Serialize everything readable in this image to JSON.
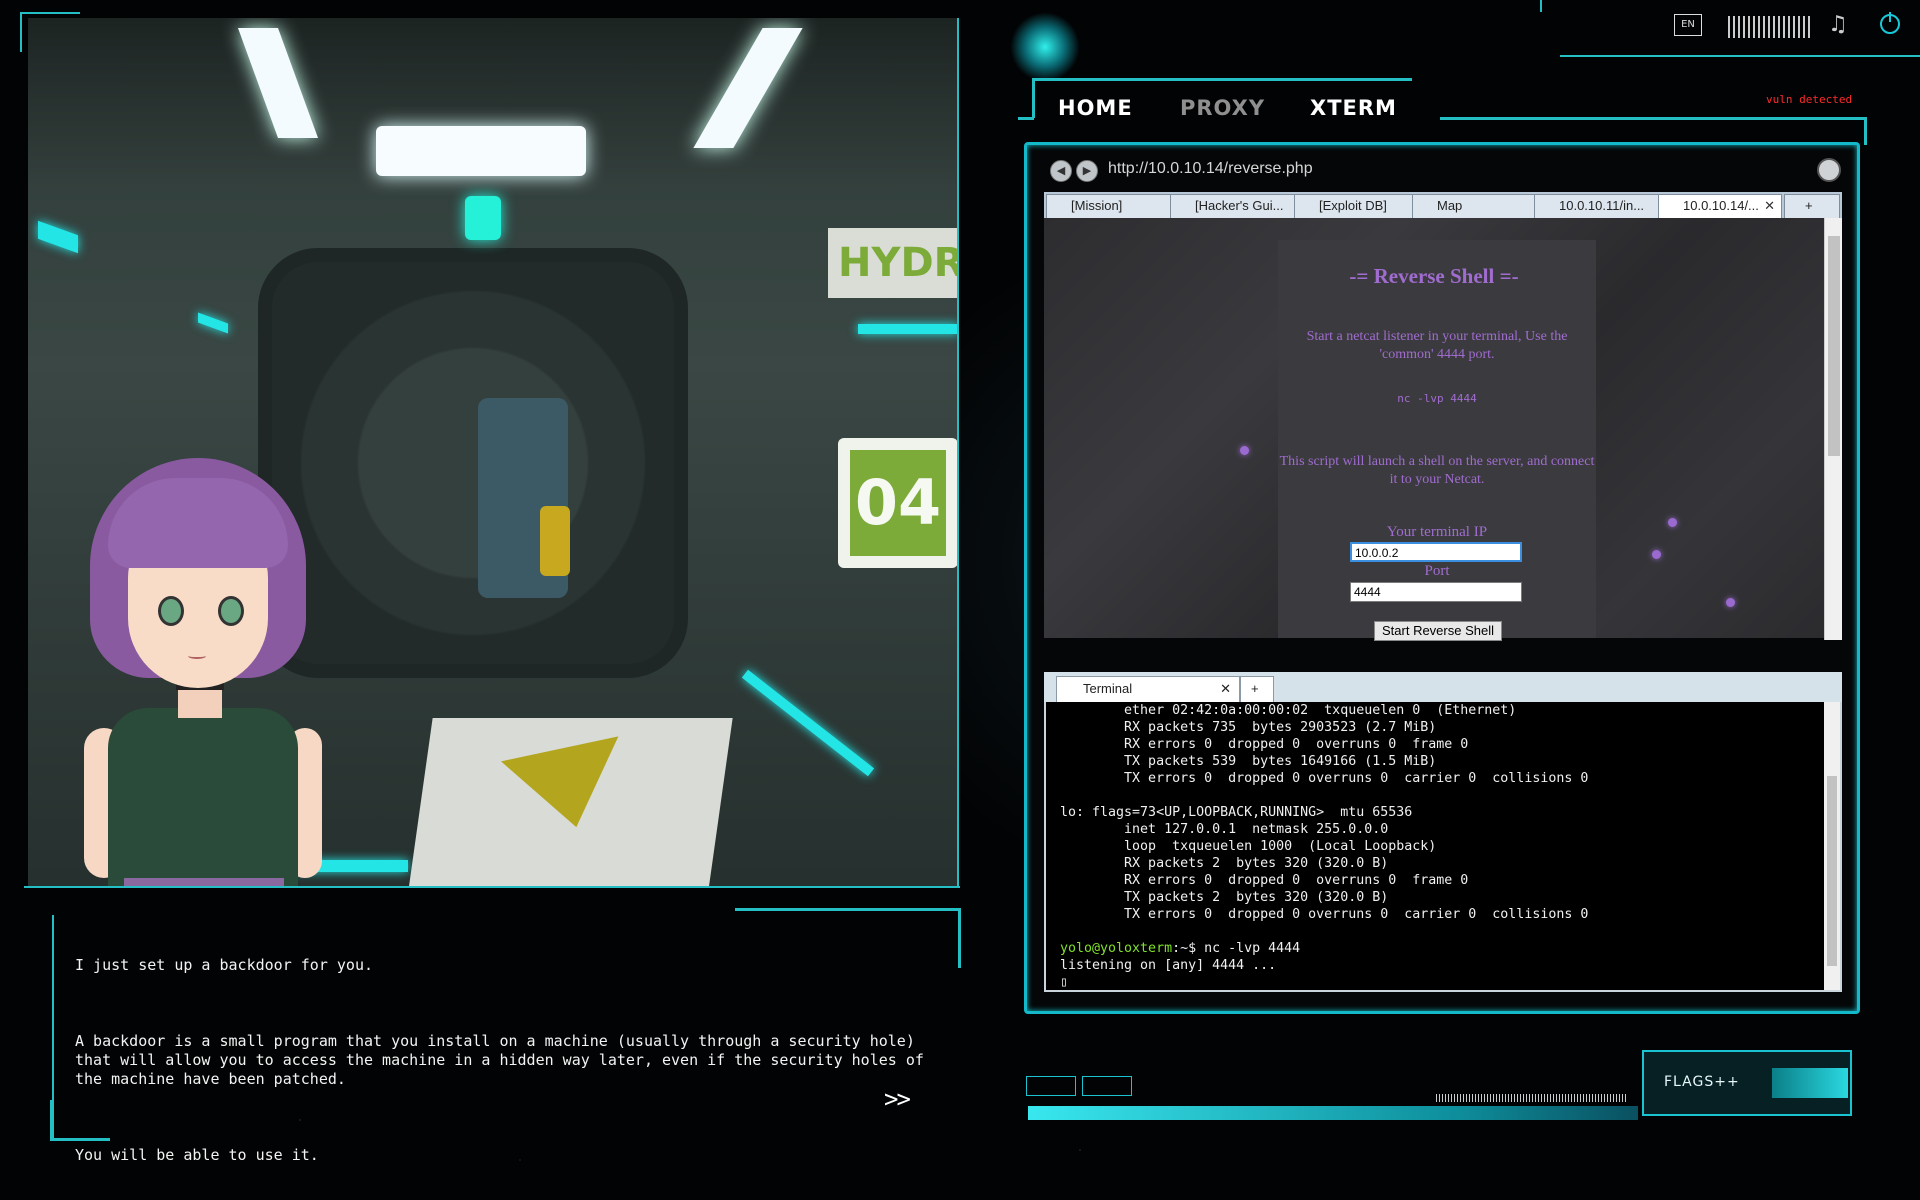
{
  "hud": {
    "language": "EN",
    "vuln_status": "vuln detected"
  },
  "nav_tabs": [
    {
      "label": "HOME",
      "active": true,
      "color": "#ffffff"
    },
    {
      "label": "PROXY",
      "active": false,
      "color": "#8f8f8f"
    },
    {
      "label": "XTERM",
      "active": true,
      "color": "#ffffff"
    }
  ],
  "browser": {
    "url": "http://10.0.10.14/reverse.php",
    "tabs": [
      {
        "label": "[Mission]"
      },
      {
        "label": "[Hacker's Gui..."
      },
      {
        "label": "[Exploit DB]"
      },
      {
        "label": "Map"
      },
      {
        "label": "10.0.10.11/in..."
      },
      {
        "label": "10.0.10.14/...",
        "active": true
      },
      {
        "label": "+"
      }
    ],
    "page": {
      "title": "-= Reverse Shell =-",
      "intro": "Start a netcat listener in your terminal, Use the 'common' 4444 port.",
      "command": "nc -lvp 4444",
      "description": "This script will launch a shell on the server, and connect it to your Netcat.",
      "ip_label": "Your terminal IP",
      "ip_value": "10.0.0.2",
      "port_label": "Port",
      "port_value": "4444",
      "button": "Start Reverse Shell"
    }
  },
  "terminal": {
    "tab_label": "Terminal",
    "add_tab": "+",
    "lines": [
      "        ether 02:42:0a:00:00:02  txqueuelen 0  (Ethernet)",
      "        RX packets 735  bytes 2903523 (2.7 MiB)",
      "        RX errors 0  dropped 0  overruns 0  frame 0",
      "        TX packets 539  bytes 1649166 (1.5 MiB)",
      "        TX errors 0  dropped 0 overruns 0  carrier 0  collisions 0",
      "",
      "lo: flags=73<UP,LOOPBACK,RUNNING>  mtu 65536",
      "        inet 127.0.0.1  netmask 255.0.0.0",
      "        loop  txqueuelen 1000  (Local Loopback)",
      "        RX packets 2  bytes 320 (320.0 B)",
      "        RX errors 0  dropped 0  overruns 0  frame 0",
      "        TX packets 2  bytes 320 (320.0 B)",
      "        TX errors 0  dropped 0 overruns 0  carrier 0  collisions 0",
      ""
    ],
    "prompt": "yolo@yoloxterm",
    "prompt_path": ":~$ ",
    "command": "nc -lvp 4444",
    "output": "listening on [any] 4444 ..."
  },
  "dialog": {
    "p1": "I just set up a backdoor for you.",
    "p2": "A backdoor is a small program that you install on a machine (usually through a security hole) that will allow you to access the machine in a hidden way later, even if the security holes of the machine have been patched.",
    "p3": "You will be able to use it.",
    "next": ">>"
  },
  "scene": {
    "sign_text": "HYDROP",
    "room_number": "04"
  },
  "flags_button": "FLAGS++",
  "colors": {
    "accent": "#19d6d6",
    "page_text": "#a06ccf",
    "prompt": "#7fe02a",
    "alert": "#ff2a2a"
  }
}
